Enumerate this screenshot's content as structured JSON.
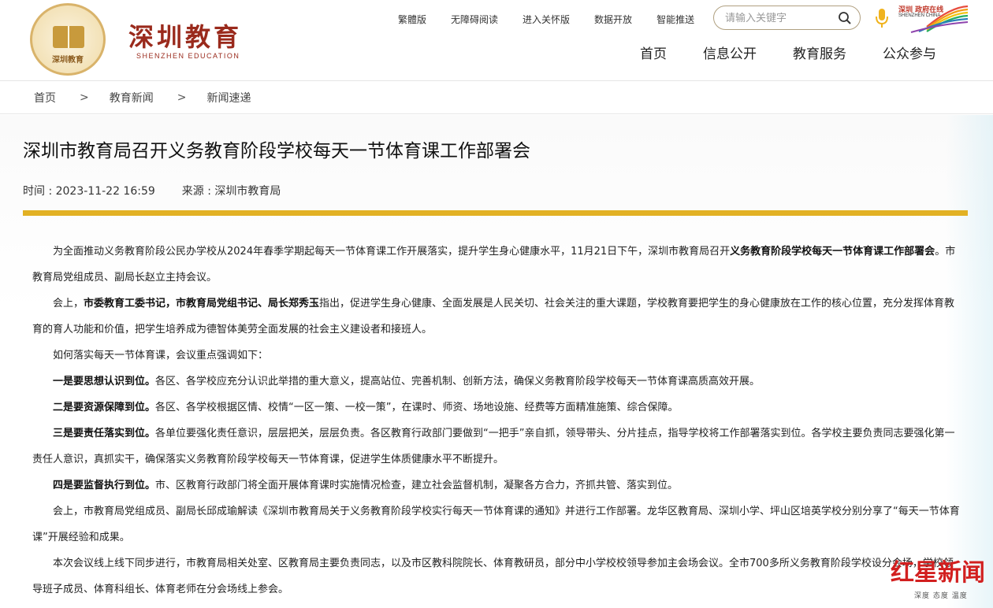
{
  "header": {
    "brand_cn": "深圳教育",
    "brand_en": "SHENZHEN EDUCATION",
    "emblem_text": "深圳教育",
    "top_links": [
      "繁體版",
      "无障碍阅读",
      "进入关怀版",
      "数据开放",
      "智能推送"
    ],
    "search_placeholder": "请输入关键字",
    "city_logo_cn": "深圳 政府在线",
    "city_logo_en": "SHENZHEN CHINA",
    "nav": [
      "首页",
      "信息公开",
      "教育服务",
      "公众参与"
    ]
  },
  "breadcrumb": [
    "首页",
    "教育新闻",
    "新闻速递"
  ],
  "article": {
    "title": "深圳市教育局召开义务教育阶段学校每天一节体育课工作部署会",
    "time_label": "时间 : 2023-11-22 16:59",
    "source_label": "来源 : 深圳市教育局",
    "paragraphs": [
      [
        {
          "t": "为全面推动义务教育阶段公民办学校从2024年春季学期起每天一节体育课工作开展落实，提升学生身心健康水平，11月21日下午，深圳市教育局召开"
        },
        {
          "t": "义务教育阶段学校每天一节体育课工作部署会",
          "b": true
        },
        {
          "t": "。市教育局党组成员、副局长赵立主持会议。"
        }
      ],
      [
        {
          "t": "会上，"
        },
        {
          "t": "市委教育工委书记，市教育局党组书记、局长郑秀玉",
          "b": true
        },
        {
          "t": "指出，促进学生身心健康、全面发展是人民关切、社会关注的重大课题，学校教育要把学生的身心健康放在工作的核心位置，充分发挥体育教育的育人功能和价值，把学生培养成为德智体美劳全面发展的社会主义建设者和接班人。"
        }
      ],
      [
        {
          "t": "如何落实每天一节体育课，会议重点强调如下："
        }
      ],
      [
        {
          "t": "一是要思想认识到位。",
          "b": true
        },
        {
          "t": "各区、各学校应充分认识此举措的重大意义，提高站位、完善机制、创新方法，确保义务教育阶段学校每天一节体育课高质高效开展。"
        }
      ],
      [
        {
          "t": "二是要资源保障到位。",
          "b": true
        },
        {
          "t": "各区、各学校根据区情、校情“一区一策、一校一策”，在课时、师资、场地设施、经费等方面精准施策、综合保障。"
        }
      ],
      [
        {
          "t": "三是要责任落实到位。",
          "b": true
        },
        {
          "t": "各单位要强化责任意识，层层把关，层层负责。各区教育行政部门要做到“一把手”亲自抓，领导带头、分片挂点，指导学校将工作部署落实到位。各学校主要负责同志要强化第一责任人意识，真抓实干，确保落实义务教育阶段学校每天一节体育课，促进学生体质健康水平不断提升。"
        }
      ],
      [
        {
          "t": "四是要监督执行到位。",
          "b": true
        },
        {
          "t": "市、区教育行政部门将全面开展体育课时实施情况检查，建立社会监督机制，凝聚各方合力，齐抓共管、落实到位。"
        }
      ],
      [
        {
          "t": "会上，市教育局党组成员、副局长邱成瑜解读《深圳市教育局关于义务教育阶段学校实行每天一节体育课的通知》并进行工作部署。龙华区教育局、深圳小学、坪山区培英学校分别分享了“每天一节体育课”开展经验和成果。"
        }
      ],
      [
        {
          "t": "本次会议线上线下同步进行，市教育局相关处室、区教育局主要负责同志，以及市区教科院院长、体育教研员，部分中小学校校领导参加主会场会议。全市700多所义务教育阶段学校设分会场，学校领导班子成员、体育科组长、体育老师在分会场线上参会。"
        }
      ]
    ]
  },
  "watermark": {
    "big": "红星新闻",
    "small": "深度 态度 温度"
  },
  "colors": {
    "gold_bar": "#e2b124",
    "brand_red": "#9a2a1c",
    "watermark_red": "#d21f1f"
  }
}
